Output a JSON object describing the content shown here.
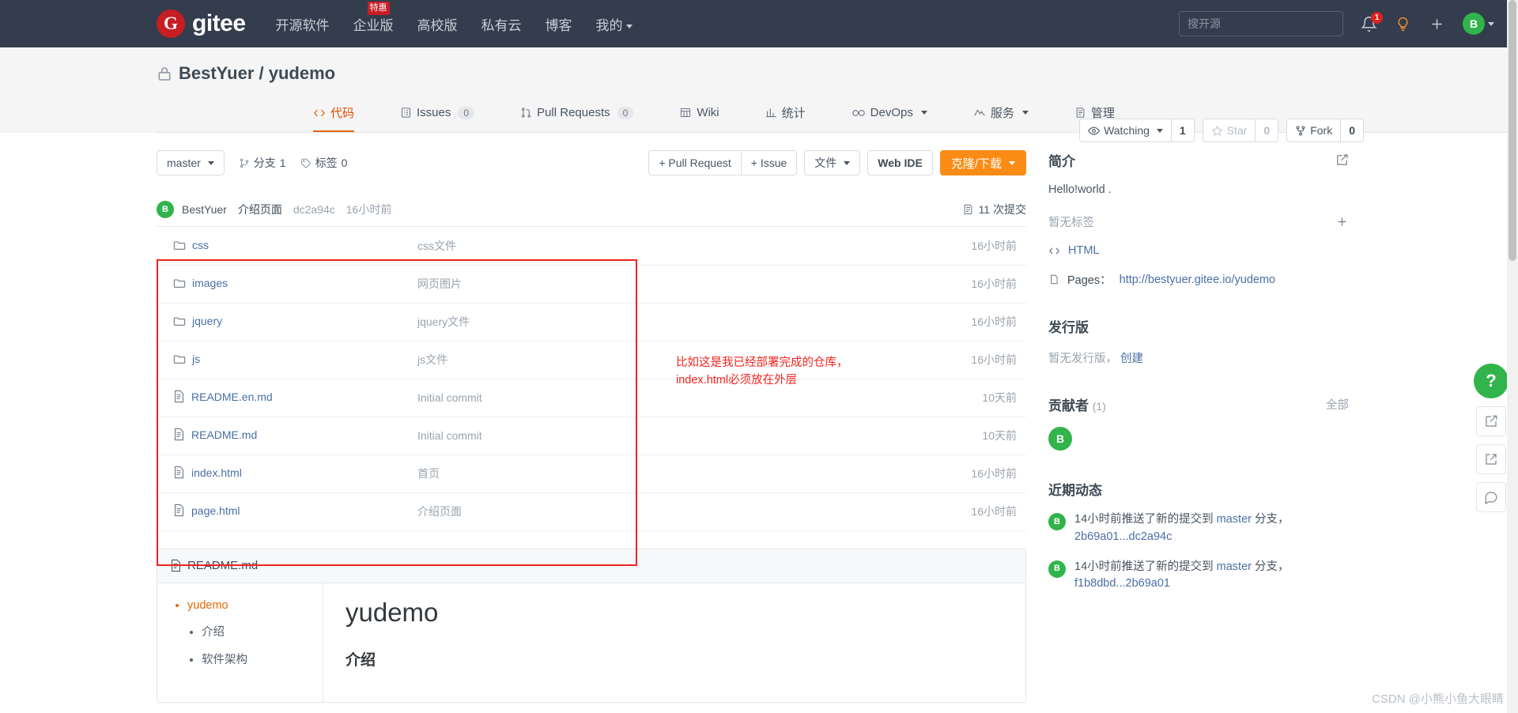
{
  "topbar": {
    "logo_text": "gitee",
    "logo_mark": "G",
    "nav": [
      {
        "label": "开源软件",
        "badge": ""
      },
      {
        "label": "企业版",
        "badge": "特惠"
      },
      {
        "label": "高校版",
        "badge": ""
      },
      {
        "label": "私有云",
        "badge": ""
      },
      {
        "label": "博客",
        "badge": ""
      },
      {
        "label": "我的",
        "badge": "",
        "has_caret": true
      }
    ],
    "search_placeholder": "搜开源",
    "notification_count": "1",
    "avatar_letter": "B"
  },
  "repo": {
    "owner": "BestYuer",
    "separator": "/",
    "name": "yudemo",
    "full_title": "BestYuer / yudemo",
    "watch_label": "Watching",
    "watch_count": "1",
    "star_label": "Star",
    "star_count": "0",
    "fork_label": "Fork",
    "fork_count": "0"
  },
  "tabs": [
    {
      "label": "代码",
      "count": "",
      "icon": "code-icon",
      "active": true
    },
    {
      "label": "Issues",
      "count": "0",
      "icon": "issue-icon",
      "active": false
    },
    {
      "label": "Pull Requests",
      "count": "0",
      "icon": "pr-icon",
      "active": false
    },
    {
      "label": "Wiki",
      "count": "",
      "icon": "wiki-icon",
      "active": false
    },
    {
      "label": "统计",
      "count": "",
      "icon": "stats-icon",
      "active": false
    },
    {
      "label": "DevOps",
      "count": "",
      "icon": "devops-icon",
      "active": false,
      "caret": true
    },
    {
      "label": "服务",
      "count": "",
      "icon": "service-icon",
      "active": false,
      "caret": true
    },
    {
      "label": "管理",
      "count": "",
      "icon": "manage-icon",
      "active": false
    }
  ],
  "toolbar": {
    "branch": "master",
    "branches_label": "分支",
    "branches_count": "1",
    "tags_label": "标签",
    "tags_count": "0",
    "pull_request_btn": "+ Pull Request",
    "issue_btn": "+ Issue",
    "files_btn": "文件",
    "webide_btn": "Web IDE",
    "clone_btn": "克隆/下载"
  },
  "commit_bar": {
    "avatar_letter": "B",
    "author": "BestYuer",
    "message": "介绍页面",
    "sha": "dc2a94c",
    "time": "16小时前",
    "commit_count": "11 次提交"
  },
  "files": [
    {
      "name": "css",
      "type": "folder",
      "desc": "css文件",
      "time": "16小时前"
    },
    {
      "name": "images",
      "type": "folder",
      "desc": "网页图片",
      "time": "16小时前"
    },
    {
      "name": "jquery",
      "type": "folder",
      "desc": "jquery文件",
      "time": "16小时前"
    },
    {
      "name": "js",
      "type": "folder",
      "desc": "js文件",
      "time": "16小时前"
    },
    {
      "name": "README.en.md",
      "type": "file",
      "desc": "Initial commit",
      "time": "10天前"
    },
    {
      "name": "README.md",
      "type": "file",
      "desc": "Initial commit",
      "time": "10天前"
    },
    {
      "name": "index.html",
      "type": "file",
      "desc": "首页",
      "time": "16小时前"
    },
    {
      "name": "page.html",
      "type": "file",
      "desc": "介绍页面",
      "time": "16小时前"
    }
  ],
  "annotation": {
    "line1": "比如这是我已经部署完成的仓库，",
    "line2": "index.html必须放在外层",
    "color": "#f0241e"
  },
  "readme": {
    "filename": "README.md",
    "toc": [
      {
        "label": "yudemo",
        "level": 1
      },
      {
        "label": "介绍",
        "level": 2
      },
      {
        "label": "软件架构",
        "level": 2
      }
    ],
    "h1": "yudemo",
    "h2": "介绍"
  },
  "sidebar": {
    "intro_title": "简介",
    "intro_text": "Hello!world .",
    "no_tags": "暂无标签",
    "add_tag": "+",
    "language": "HTML",
    "pages_label": "Pages：",
    "pages_url": "http://bestyuer.gitee.io/yudemo",
    "release_title": "发行版",
    "release_empty": "暂无发行版，",
    "release_create": "创建",
    "contributors_title": "贡献者",
    "contributors_count": "(1)",
    "contributors_all": "全部",
    "contributor_letter": "B",
    "activity_title": "近期动态",
    "activities": [
      {
        "avatar": "B",
        "prefix": "14小时前推送了新的提交到 ",
        "branch": "master",
        "middle": " 分支，",
        "sha": "2b69a01...dc2a94c"
      },
      {
        "avatar": "B",
        "prefix": "14小时前推送了新的提交到 ",
        "branch": "master",
        "middle": " 分支，",
        "sha": "f1b8dbd...2b69a01"
      }
    ]
  },
  "rail": {
    "help": "?",
    "edit": "edit-icon",
    "share": "share-icon",
    "comment": "comment-icon"
  },
  "watermark": "CSDN @小熊小鱼大眼睛",
  "colors": {
    "accent": "#e4690b",
    "orange_btn": "#fa8c16",
    "brand_red": "#c71d23",
    "link_blue": "#4a6fa5",
    "green": "#31b44b",
    "annotation_red": "#f0241e",
    "topbar_bg": "#333d4d"
  }
}
